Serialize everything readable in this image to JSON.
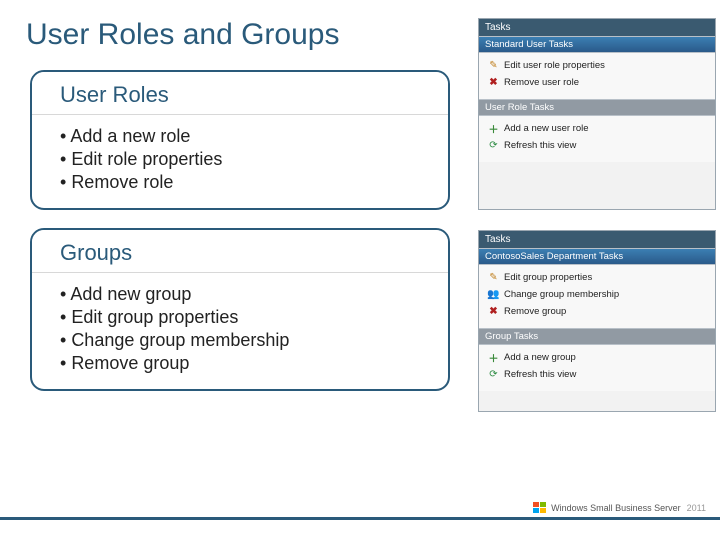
{
  "title": "User Roles and Groups",
  "sections": [
    {
      "header": "User Roles",
      "items": [
        "Add a new role",
        "Edit role properties",
        "Remove role"
      ]
    },
    {
      "header": "Groups",
      "items": [
        "Add new group",
        "Edit group properties",
        "Change group membership",
        "Remove group"
      ]
    }
  ],
  "panels": {
    "roles": {
      "title": "Tasks",
      "sub1": "Standard User Tasks",
      "items1": [
        {
          "icon": "edit",
          "label": "Edit user role properties"
        },
        {
          "icon": "del",
          "label": "Remove user role"
        }
      ],
      "sub2": "User Role Tasks",
      "items2": [
        {
          "icon": "add",
          "label": "Add a new user role"
        },
        {
          "icon": "ref",
          "label": "Refresh this view"
        }
      ]
    },
    "groups": {
      "title": "Tasks",
      "sub1": "ContosoSales Department Tasks",
      "items1": [
        {
          "icon": "edit",
          "label": "Edit group properties"
        },
        {
          "icon": "grp",
          "label": "Change group membership"
        },
        {
          "icon": "del",
          "label": "Remove group"
        }
      ],
      "sub2": "Group Tasks",
      "items2": [
        {
          "icon": "add",
          "label": "Add a new group"
        },
        {
          "icon": "ref",
          "label": "Refresh this view"
        }
      ]
    }
  },
  "footer": {
    "product": "Windows Small Business Server",
    "year": "2011"
  }
}
